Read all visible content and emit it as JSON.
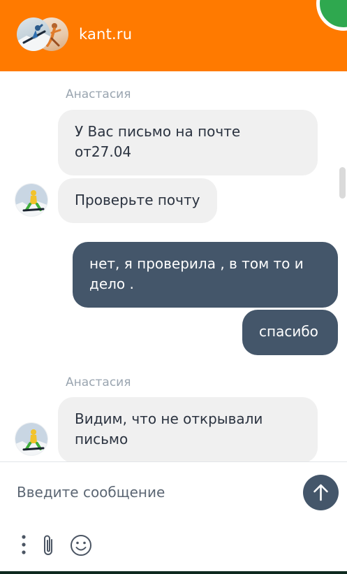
{
  "header": {
    "title": "kant.ru",
    "avatars": [
      "operator-avatar-snowboard",
      "operator-avatar-yoga"
    ]
  },
  "messages": [
    {
      "direction": "in",
      "sender": "Анастасия",
      "lines": [
        "У Вас письмо на почте",
        "от27.04"
      ]
    },
    {
      "direction": "in",
      "lines": [
        "Проверьте почту"
      ]
    },
    {
      "direction": "out",
      "lines": [
        "нет, я проверила , в том то и",
        "дело ."
      ]
    },
    {
      "direction": "out",
      "lines": [
        "спасибо"
      ]
    },
    {
      "direction": "in",
      "sender": "Анастасия",
      "lines": [
        "Видим, что не открывали",
        "письмо"
      ]
    }
  ],
  "composer": {
    "placeholder": "Введите сообщение",
    "icons": {
      "send": "arrow-up-icon",
      "more": "vertical-dots-icon",
      "attach": "paperclip-icon",
      "emoji": "smiley-icon"
    }
  },
  "colors": {
    "header": "#ff7a00",
    "outgoing_bubble": "#44566a",
    "incoming_bubble": "#f0f0f0",
    "sender_name": "#9aa5b0"
  }
}
